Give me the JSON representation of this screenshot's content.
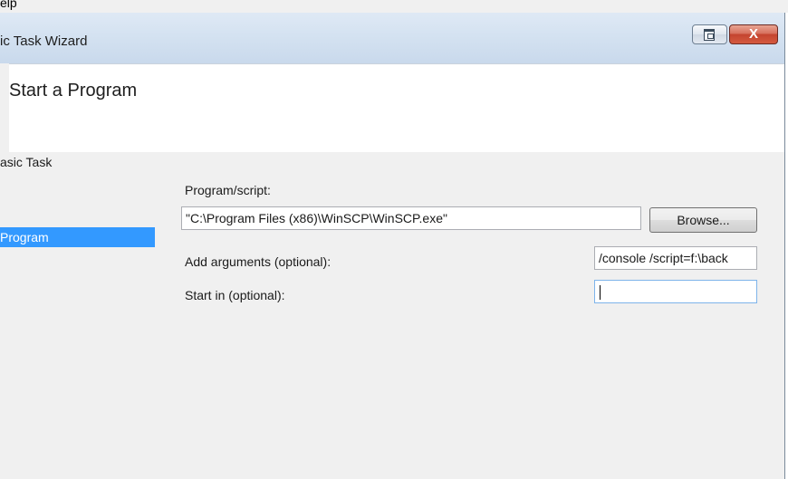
{
  "menu_bar": {
    "item": "elp"
  },
  "window": {
    "title": "ic Task Wizard",
    "close_glyph": "X",
    "restore_icon": "restore-window-icon"
  },
  "header": {
    "title": "Start a Program"
  },
  "sidebar": {
    "items": [
      {
        "label": "asic Task",
        "selected": false
      },
      {
        "label": "Program",
        "selected": true
      }
    ]
  },
  "form": {
    "program_script": {
      "label": "Program/script:",
      "value": "\"C:\\Program Files (x86)\\WinSCP\\WinSCP.exe\""
    },
    "browse_label": "Browse...",
    "arguments": {
      "label": "Add arguments (optional):",
      "value": "/console /script=f:\\back"
    },
    "start_in": {
      "label": "Start in (optional):",
      "value": ""
    }
  },
  "colors": {
    "selection": "#3399ff",
    "close_button": "#c4442f",
    "panel_background": "#f0f0f0"
  }
}
